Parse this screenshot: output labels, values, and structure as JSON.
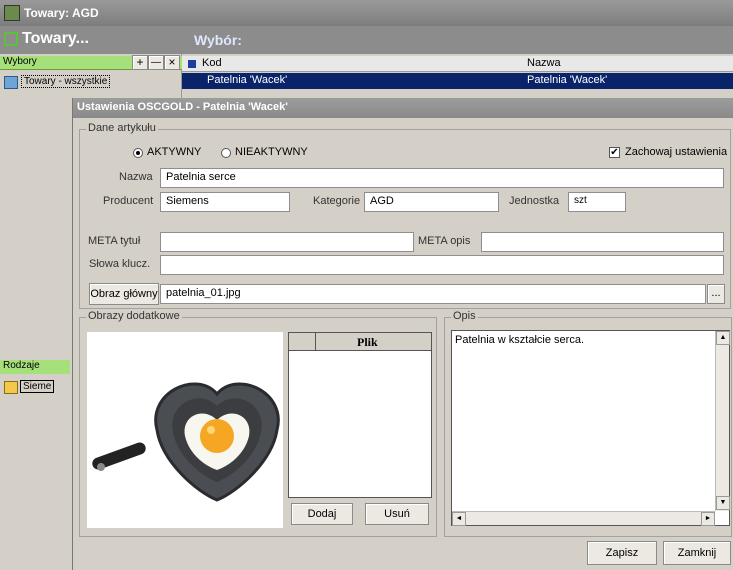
{
  "window": {
    "title": "Towary: AGD"
  },
  "left_panel": {
    "title": "Towary...",
    "section_label": "Wybory",
    "add": "+",
    "remove": "—",
    "close": "×",
    "tree_item": "Towary - wszystkie",
    "section2_label": "Rodzaje",
    "tree_item2": "Sieme"
  },
  "right_panel": {
    "title": "Wybór:",
    "columns": [
      "Kod",
      "Nazwa"
    ],
    "rows": [
      {
        "kod": "Patelnia 'Wacek'",
        "nazwa": "Patelnia 'Wacek'"
      }
    ]
  },
  "dialog": {
    "title": "Ustawienia OSCGOLD - Patelnia 'Wacek'",
    "group_product": "Dane artykułu",
    "radio_active": "AKTYWNY",
    "radio_inactive": "NIEAKTYWNY",
    "active_selected": true,
    "keep_settings_label": "Zachowaj ustawienia",
    "keep_settings_checked": true,
    "name_label": "Nazwa",
    "name_value": "Patelnia serce",
    "producer_label": "Producent",
    "producer_value": "Siemens",
    "category_label": "Kategorie",
    "category_value": "AGD",
    "unit_label": "Jednostka",
    "unit_value": "szt",
    "meta_title_label": "META tytuł",
    "meta_title_value": "",
    "meta_desc_label": "META opis",
    "meta_desc_value": "",
    "keywords_label": "Słowa klucz.",
    "keywords_value": "",
    "main_image_button": "Obraz główny",
    "main_image_value": "patelnia_01.jpg",
    "browse_button": "...",
    "group_images": "Obrazy dodatkowe",
    "file_column": "Plik",
    "add_button": "Dodaj",
    "remove_button": "Usuń",
    "group_desc": "Opis",
    "desc_value": "Patelnia w kształcie serca.",
    "save_button": "Zapisz",
    "close_button": "Zamknij"
  }
}
